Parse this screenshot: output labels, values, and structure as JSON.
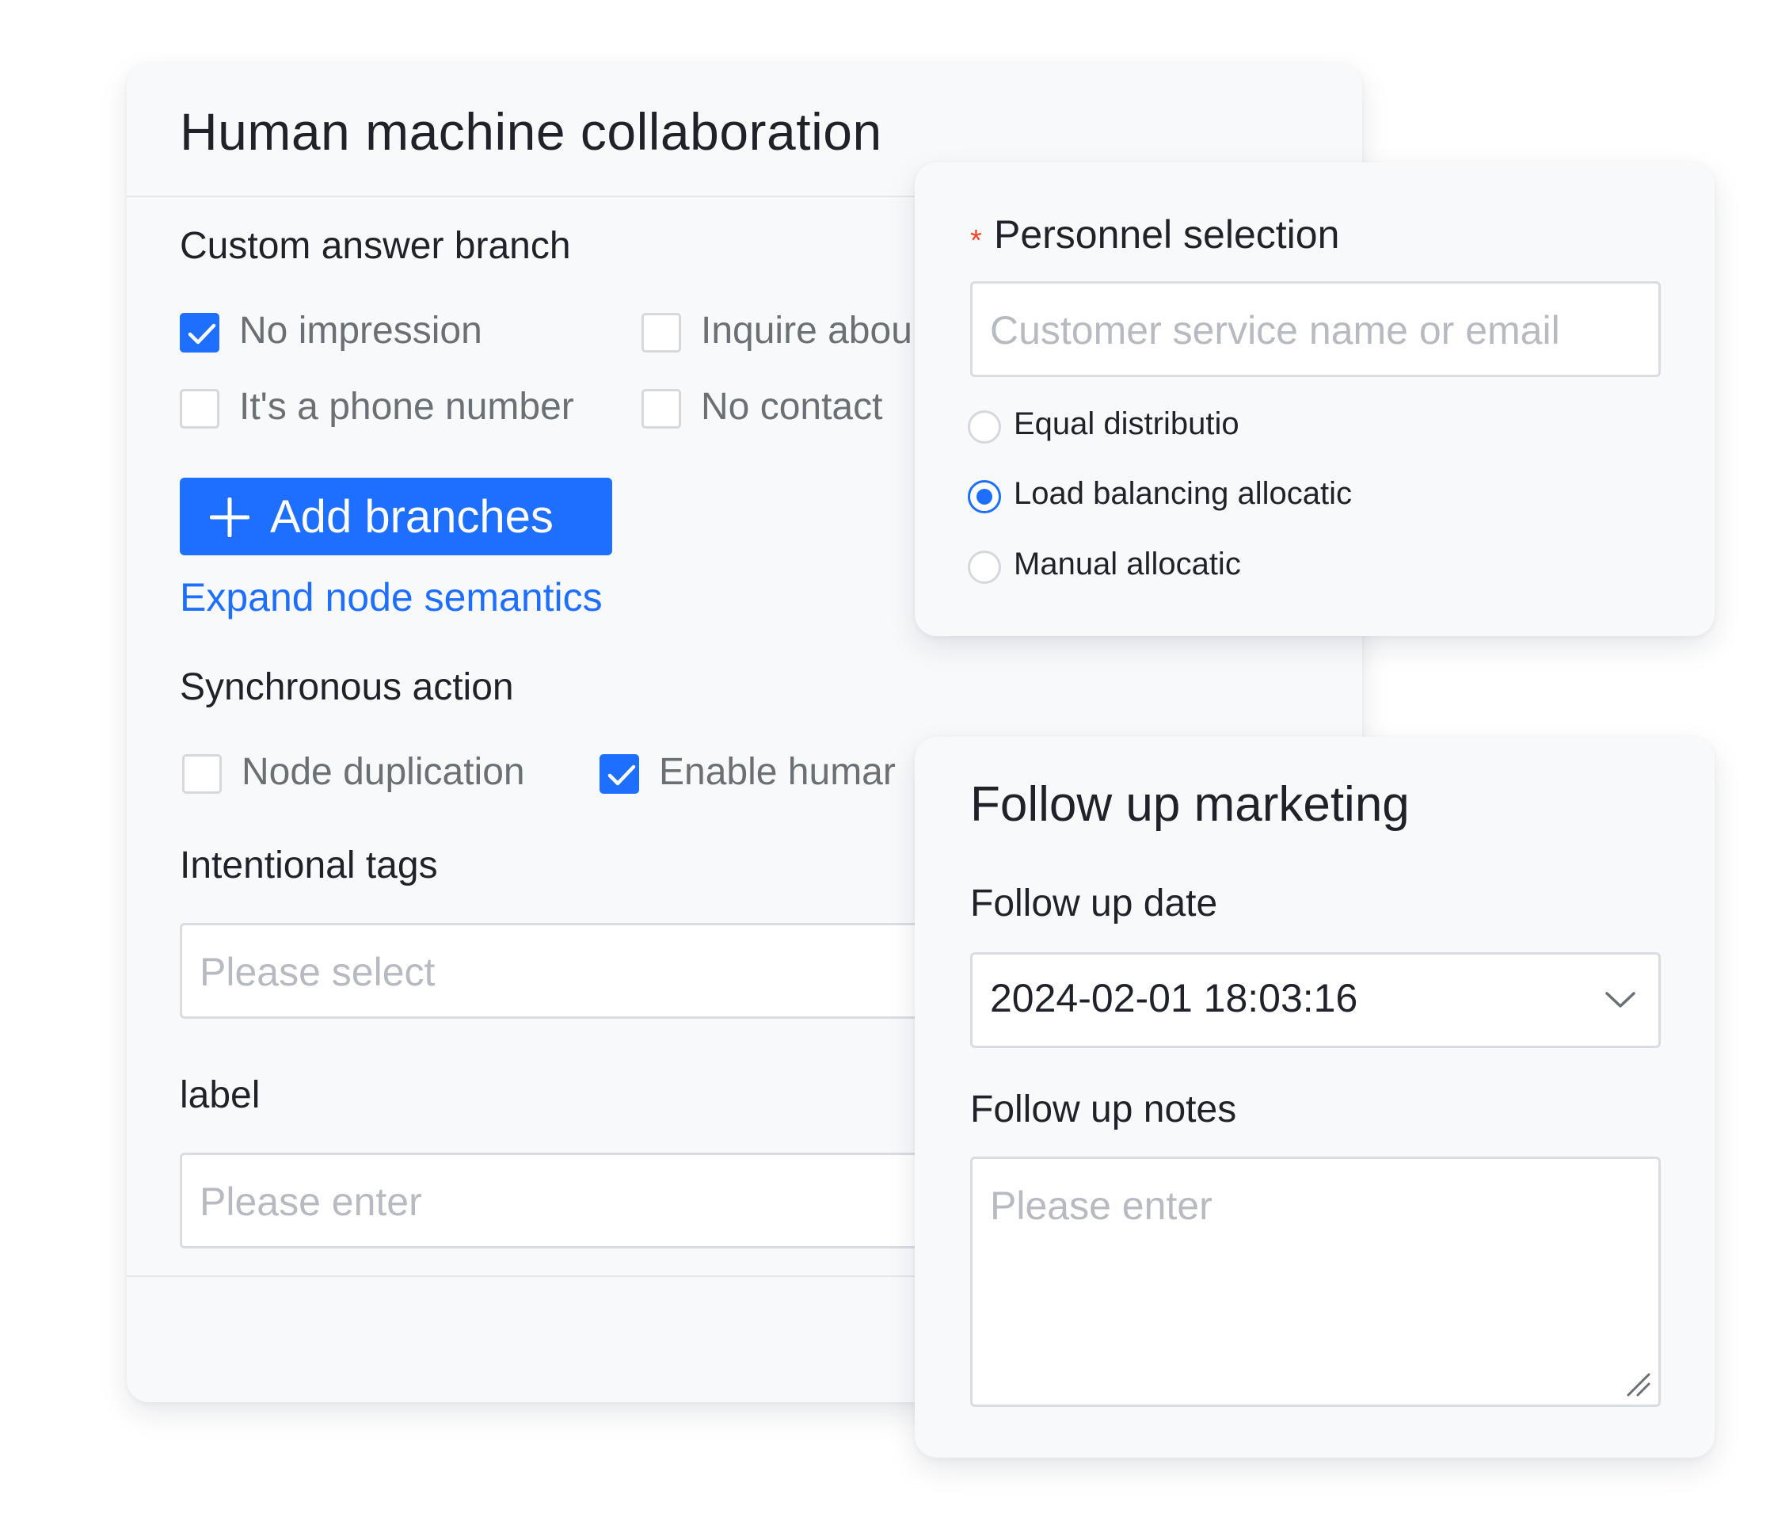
{
  "main": {
    "title": "Human machine collaboration",
    "custom_answer_branch": {
      "label": "Custom answer branch",
      "options": [
        {
          "label": "No impression",
          "checked": true
        },
        {
          "label": "Inquire abou",
          "checked": false
        },
        {
          "label": "It's a phone number",
          "checked": false
        },
        {
          "label": "No contact",
          "checked": false
        }
      ],
      "add_button_label": "Add branches",
      "expand_link": "Expand node semantics"
    },
    "synchronous_action": {
      "label": "Synchronous action",
      "options": [
        {
          "label": "Node duplication",
          "checked": false
        },
        {
          "label": "Enable humar",
          "checked": true
        }
      ]
    },
    "intentional_tags": {
      "label": "Intentional tags",
      "placeholder": "Please select"
    },
    "label_field": {
      "label": "label",
      "placeholder": "Please enter"
    }
  },
  "personnel": {
    "label": "Personnel selection",
    "required_mark": "*",
    "search_placeholder": "Customer service name or email",
    "options": [
      {
        "label": "Equal distributio",
        "selected": false
      },
      {
        "label": "Load balancing allocatic",
        "selected": true
      },
      {
        "label": "Manual allocatic",
        "selected": false
      }
    ]
  },
  "follow": {
    "title": "Follow up marketing",
    "date_label": "Follow up date",
    "date_value": "2024-02-01  18:03:16",
    "notes_label": "Follow up notes",
    "notes_placeholder": "Please enter"
  },
  "colors": {
    "accent": "#1f6fff",
    "required": "#f5432a",
    "card_bg": "#f8f9fb",
    "text_primary": "#1f2329",
    "text_muted": "#6b7075",
    "placeholder": "#b7bbc1"
  },
  "icons": [
    "check-icon",
    "plus-icon",
    "chevron-down-icon",
    "resize-handle-icon"
  ]
}
